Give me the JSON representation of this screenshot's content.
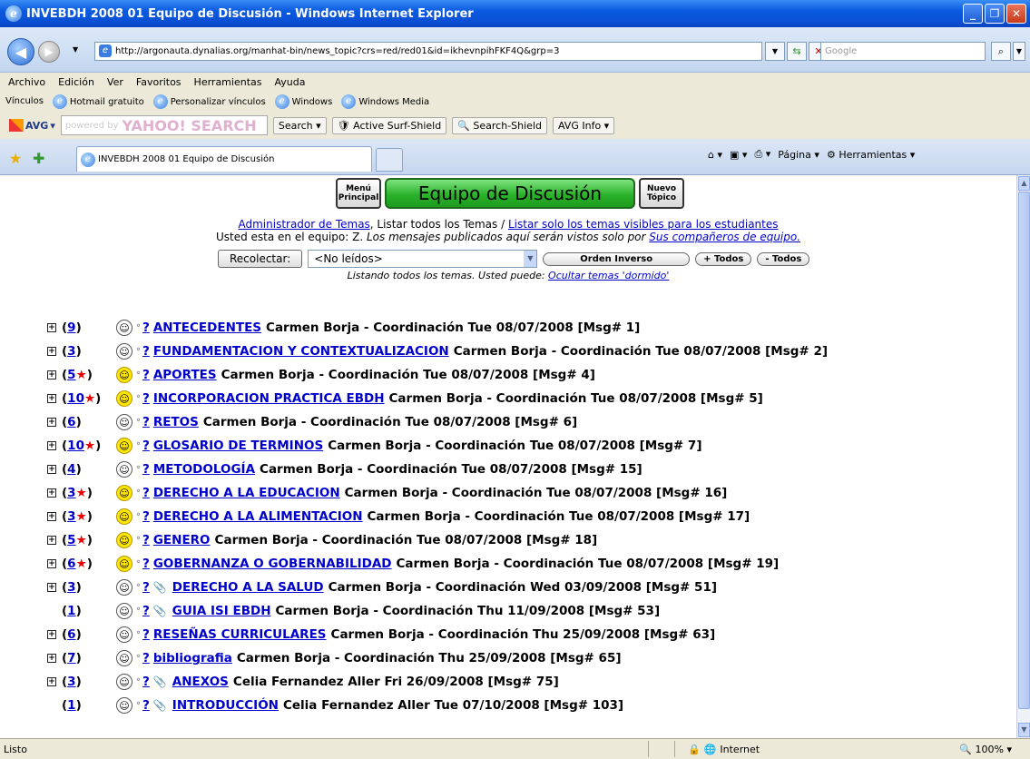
{
  "window": {
    "title": "INVEBDH 2008 01 Equipo de Discusión - Windows Internet Explorer",
    "controls": [
      "_",
      "❐",
      "✕"
    ]
  },
  "addressbar": {
    "url": "http://argonauta.dynalias.org/manhat-bin/news_topic?crs=red/red01&id=ikhevnpihFKF4Q&grp=3",
    "search_placeholder": "Google"
  },
  "menubar": [
    "Archivo",
    "Edición",
    "Ver",
    "Favoritos",
    "Herramientas",
    "Ayuda"
  ],
  "linksbar": {
    "label": "Vínculos",
    "items": [
      "Hotmail gratuito",
      "Personalizar vínculos",
      "Windows",
      "Windows Media"
    ]
  },
  "avgbar": {
    "logo": "AVG",
    "yahoo_text": "powered by",
    "yahoo_brand": "YAHOO! SEARCH",
    "search_label": "Search",
    "surf_shield": "Active Surf-Shield",
    "search_shield": "Search-Shield",
    "avg_info": "AVG Info"
  },
  "tabs": {
    "active": "INVEBDH 2008 01 Equipo de Discusión",
    "tools": [
      "Página",
      "Herramientas"
    ]
  },
  "page": {
    "menu_principal": "Menú Principal",
    "heading": "Equipo de Discusión",
    "nuevo_topico": "Nuevo Tópico",
    "admin_link": "Administrador de Temas",
    "listar_todos": ", Listar todos los Temas / ",
    "listar_visibles": "Listar solo los temas visibles para los estudiantes",
    "team_prefix": "Usted esta en el equipo: Z. ",
    "team_note": "Los mensajes publicados aquí serán vistos solo por ",
    "team_link": "Sus compañeros de equipo.",
    "recolectar": "Recolectar:",
    "select_value": "<No leídos>",
    "orden_inverso": "Orden Inverso",
    "mas_todos": "+ Todos",
    "menos_todos": "- Todos",
    "listing_text": "Listando todos los temas. Usted puede: ",
    "listing_link": "Ocultar temas 'dormido'"
  },
  "topics": [
    {
      "expand": true,
      "count": "9",
      "new": false,
      "face": "grey",
      "clip": false,
      "title": "ANTECEDENTES",
      "meta": "Carmen Borja - Coordinación Tue 08/07/2008 [Msg# 1]"
    },
    {
      "expand": true,
      "count": "3",
      "new": false,
      "face": "grey",
      "clip": false,
      "title": "FUNDAMENTACION Y CONTEXTUALIZACION",
      "meta": "Carmen Borja - Coordinación Tue 08/07/2008 [Msg# 2]"
    },
    {
      "expand": true,
      "count": "5",
      "new": true,
      "face": "yellow",
      "clip": false,
      "title": "APORTES",
      "meta": "Carmen Borja - Coordinación Tue 08/07/2008 [Msg# 4]"
    },
    {
      "expand": true,
      "count": "10",
      "new": true,
      "face": "yellow",
      "clip": false,
      "title": "INCORPORACION PRACTICA EBDH",
      "meta": "Carmen Borja - Coordinación Tue 08/07/2008 [Msg# 5]"
    },
    {
      "expand": true,
      "count": "6",
      "new": false,
      "face": "grey",
      "clip": false,
      "title": "RETOS",
      "meta": "Carmen Borja - Coordinación Tue 08/07/2008 [Msg# 6]"
    },
    {
      "expand": true,
      "count": "10",
      "new": true,
      "face": "yellow",
      "clip": false,
      "title": "GLOSARIO DE TERMINOS",
      "meta": "Carmen Borja - Coordinación Tue 08/07/2008 [Msg# 7]"
    },
    {
      "expand": true,
      "count": "4",
      "new": false,
      "face": "grey",
      "clip": false,
      "title": "METODOLOGÍA",
      "meta": "Carmen Borja - Coordinación Tue 08/07/2008 [Msg# 15]"
    },
    {
      "expand": true,
      "count": "3",
      "new": true,
      "face": "yellow",
      "clip": false,
      "title": "DERECHO A LA EDUCACION",
      "meta": "Carmen Borja - Coordinación Tue 08/07/2008 [Msg# 16]"
    },
    {
      "expand": true,
      "count": "3",
      "new": true,
      "face": "yellow",
      "clip": false,
      "title": "DERECHO A LA ALIMENTACION",
      "meta": "Carmen Borja - Coordinación Tue 08/07/2008 [Msg# 17]"
    },
    {
      "expand": true,
      "count": "5",
      "new": true,
      "face": "yellow",
      "clip": false,
      "title": "GENERO",
      "meta": "Carmen Borja - Coordinación Tue 08/07/2008 [Msg# 18]"
    },
    {
      "expand": true,
      "count": "6",
      "new": true,
      "face": "yellow",
      "clip": false,
      "title": "GOBERNANZA O GOBERNABILIDAD",
      "meta": "Carmen Borja - Coordinación Tue 08/07/2008 [Msg# 19]"
    },
    {
      "expand": true,
      "count": "3",
      "new": false,
      "face": "grey",
      "clip": true,
      "title": "DERECHO A LA SALUD",
      "meta": "Carmen Borja - Coordinación Wed 03/09/2008 [Msg# 51]"
    },
    {
      "expand": false,
      "count": "1",
      "new": false,
      "face": "grey",
      "clip": true,
      "title": "GUIA ISI EBDH",
      "meta": "Carmen Borja - Coordinación Thu 11/09/2008 [Msg# 53]"
    },
    {
      "expand": true,
      "count": "6",
      "new": false,
      "face": "grey",
      "clip": false,
      "title": "RESEÑAS CURRICULARES",
      "meta": "Carmen Borja - Coordinación Thu 25/09/2008 [Msg# 63]"
    },
    {
      "expand": true,
      "count": "7",
      "new": false,
      "face": "grey",
      "clip": false,
      "title": "bibliografia",
      "meta": "Carmen Borja - Coordinación Thu 25/09/2008 [Msg# 65]"
    },
    {
      "expand": true,
      "count": "3",
      "new": false,
      "face": "grey",
      "clip": true,
      "title": "ANEXOS",
      "meta": "Celia Fernandez Aller Fri 26/09/2008 [Msg# 75]"
    },
    {
      "expand": false,
      "count": "1",
      "new": false,
      "face": "grey",
      "clip": true,
      "title": "INTRODUCCIÓN",
      "meta": "Celia Fernandez Aller Tue 07/10/2008 [Msg# 103]"
    }
  ],
  "statusbar": {
    "text": "Listo",
    "zone": "Internet",
    "zoom": "100%"
  }
}
